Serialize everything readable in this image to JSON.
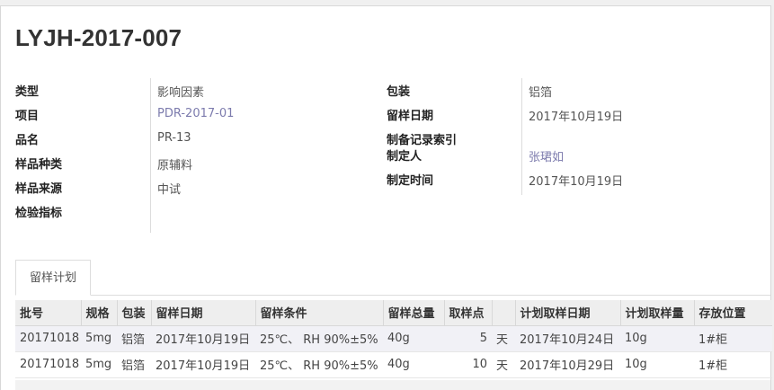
{
  "record": {
    "title": "LYJH-2017-007"
  },
  "left_fields": [
    {
      "label": "类型",
      "value": "影响因素"
    },
    {
      "label": "项目",
      "value": "PDR-2017-01"
    },
    {
      "label": "品名",
      "value": "PR-13"
    },
    {
      "label": "样品种类",
      "value": "原辅料"
    },
    {
      "label": "样品来源",
      "value": "中试"
    },
    {
      "label": "检验指标",
      "value": ""
    }
  ],
  "right_fields": [
    {
      "label": "包装",
      "value": "铝箔"
    },
    {
      "label": "留样日期",
      "value": "2017年10月19日"
    },
    {
      "label": "制备记录索引",
      "value": ""
    },
    {
      "label": "制定人",
      "value": "张珺如"
    },
    {
      "label": "制定时间",
      "value": "2017年10月19日"
    }
  ],
  "tabs": [
    {
      "label": "留样计划",
      "active": true
    }
  ],
  "table": {
    "columns": [
      "批号",
      "规格",
      "包装",
      "留样日期",
      "留样条件",
      "留样总量",
      "取样点",
      "",
      "计划取样日期",
      "计划取样量",
      "存放位置"
    ],
    "rows": [
      [
        "20171018",
        "5mg",
        "铝箔",
        "2017年10月19日",
        "25℃、 RH 90%±5%",
        "40g",
        "5",
        "天",
        "2017年10月24日",
        "10g",
        "1#柜"
      ],
      [
        "20171018",
        "5mg",
        "铝箔",
        "2017年10月19日",
        "25℃、 RH 90%±5%",
        "40g",
        "10",
        "天",
        "2017年10月29日",
        "10g",
        "1#柜"
      ]
    ]
  },
  "colors": {
    "link": "#7c7bad",
    "header_bg": "#eeeeee",
    "row_alt_bg": "#f1f1f6"
  }
}
